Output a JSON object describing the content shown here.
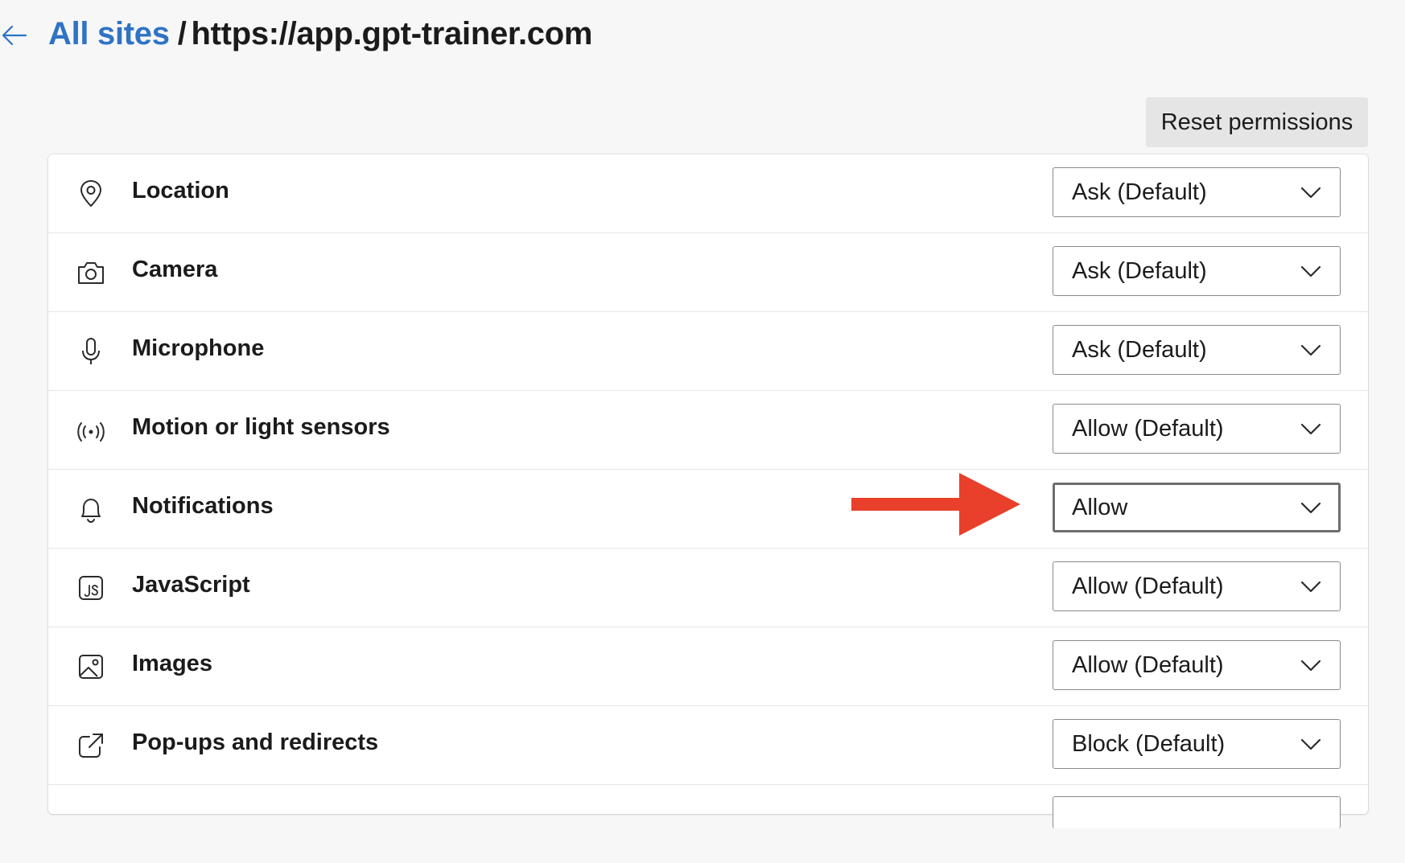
{
  "breadcrumb": {
    "parent": "All sites",
    "separator": "/",
    "current": "https://app.gpt-trainer.com"
  },
  "toolbar": {
    "reset_label": "Reset permissions"
  },
  "permissions": [
    {
      "label": "Location",
      "value": "Ask (Default)",
      "icon": "location-pin-icon"
    },
    {
      "label": "Camera",
      "value": "Ask (Default)",
      "icon": "camera-icon"
    },
    {
      "label": "Microphone",
      "value": "Ask (Default)",
      "icon": "microphone-icon"
    },
    {
      "label": "Motion or light sensors",
      "value": "Allow (Default)",
      "icon": "sensor-icon"
    },
    {
      "label": "Notifications",
      "value": "Allow",
      "icon": "bell-icon"
    },
    {
      "label": "JavaScript",
      "value": "Allow (Default)",
      "icon": "javascript-icon"
    },
    {
      "label": "Images",
      "value": "Allow (Default)",
      "icon": "image-icon"
    },
    {
      "label": "Pop-ups and redirects",
      "value": "Block (Default)",
      "icon": "popup-icon"
    }
  ],
  "colors": {
    "link": "#2f73c5",
    "annotation_arrow": "#e8402b",
    "background": "#f7f7f7"
  }
}
